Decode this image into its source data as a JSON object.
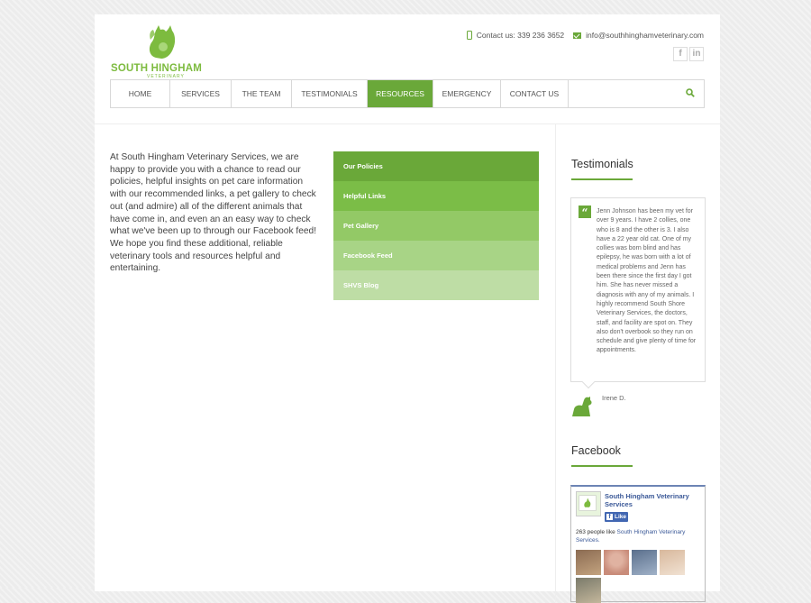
{
  "brand": {
    "name": "SOUTH HINGHAM",
    "subtitle": "VETERINARY",
    "accent_color": "#6aa839"
  },
  "contact": {
    "phone": "Contact us: 339 236 3652",
    "email": "info@southhinghamveterinary.com"
  },
  "social": [
    {
      "icon": "facebook-icon",
      "label": "f"
    },
    {
      "icon": "linkedin-icon",
      "label": "in"
    }
  ],
  "nav": {
    "items": [
      {
        "label": "HOME",
        "active": false
      },
      {
        "label": "SERVICES",
        "active": false
      },
      {
        "label": "THE TEAM",
        "active": false
      },
      {
        "label": "TESTIMONIALS",
        "active": false
      },
      {
        "label": "RESOURCES",
        "active": true
      },
      {
        "label": "EMERGENCY",
        "active": false
      },
      {
        "label": "CONTACT US",
        "active": false
      }
    ]
  },
  "main": {
    "intro": "At South Hingham Veterinary Services, we are happy to provide you with a chance to read our policies, helpful insights on pet care information with our recommended links, a pet gallery to check out (and admire) all of the different animals that have come in, and even an an easy way to check what we've been up to through our Facebook feed! We hope you find these additional, reliable veterinary tools and resources helpful and entertaining."
  },
  "resources_menu": [
    {
      "label": "Our Policies",
      "color": "#6aa839"
    },
    {
      "label": "Helpful Links",
      "color": "#7bbd47"
    },
    {
      "label": "Pet Gallery",
      "color": "#93c966"
    },
    {
      "label": "Facebook Feed",
      "color": "#a8d486"
    },
    {
      "label": "SHVS Blog",
      "color": "#bedda5"
    }
  ],
  "sidebar": {
    "testimonials_title": "Testimonials",
    "testimonial_text": "Jenn Johnson has been my vet for over 9 years. I have 2 collies, one who is 8 and the other is 3. I also have a 22 year old cat. One of my collies was born blind and has epilepsy, he was born with a lot of medical problems and Jenn has been there since the first day I got him. She has never missed a diagnosis with any of my animals. I highly recommend South Shore Veterinary Services, the doctors, staff, and facility are spot on. They also don't overbook so they run on schedule and give plenty of time for appointments.",
    "testimonial_author": "Irene D.",
    "facebook_title": "Facebook"
  },
  "facebook_widget": {
    "page_name": "South Hingham Veterinary Services",
    "like_label": "Like",
    "count_text": "263 people like ",
    "count_link": "South Hingham Veterinary Services.",
    "faces": [
      "#8b6b52",
      "#c98c7a",
      "#5a6f8c",
      "#d8b89c",
      "#7a7a6a"
    ]
  }
}
